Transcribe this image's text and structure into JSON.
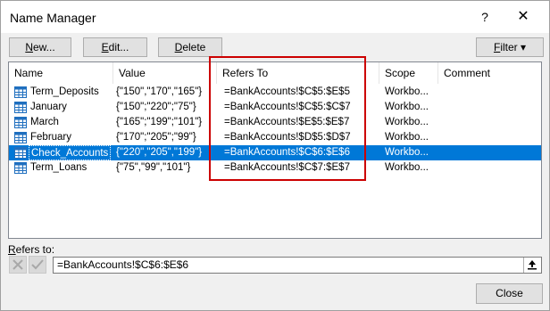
{
  "dialog": {
    "title": "Name Manager",
    "help_label": "?",
    "close_label": "✕"
  },
  "toolbar": {
    "new_label_ul": "N",
    "new_label_rest": "ew...",
    "edit_label_ul": "E",
    "edit_label_rest": "dit...",
    "delete_label_ul": "D",
    "delete_label_rest": "elete",
    "filter_label_ul": "F",
    "filter_label_rest": "ilter ▾"
  },
  "columns": {
    "name": "Name",
    "value": "Value",
    "refers_to": "Refers To",
    "scope": "Scope",
    "comment": "Comment"
  },
  "rows": [
    {
      "name": "Term_Deposits",
      "value": "{\"150\",\"170\",\"165\"}",
      "refers_to": "=BankAccounts!$C$5:$E$5",
      "scope": "Workbo...",
      "selected": false
    },
    {
      "name": "January",
      "value": "{\"150\";\"220\";\"75\"}",
      "refers_to": "=BankAccounts!$C$5:$C$7",
      "scope": "Workbo...",
      "selected": false
    },
    {
      "name": "March",
      "value": "{\"165\";\"199\";\"101\"}",
      "refers_to": "=BankAccounts!$E$5:$E$7",
      "scope": "Workbo...",
      "selected": false
    },
    {
      "name": "February",
      "value": "{\"170\";\"205\";\"99\"}",
      "refers_to": "=BankAccounts!$D$5:$D$7",
      "scope": "Workbo...",
      "selected": false
    },
    {
      "name": "Check_Accounts",
      "value": "{\"220\",\"205\",\"199\"}",
      "refers_to": "=BankAccounts!$C$6:$E$6",
      "scope": "Workbo...",
      "selected": true
    },
    {
      "name": "Term_Loans",
      "value": "{\"75\",\"99\",\"101\"}",
      "refers_to": "=BankAccounts!$C$7:$E$7",
      "scope": "Workbo...",
      "selected": false
    }
  ],
  "refers_to": {
    "label_ul": "R",
    "label_rest": "efers to:",
    "value": "=BankAccounts!$C$6:$E$6"
  },
  "footer": {
    "close_label": "Close"
  },
  "colors": {
    "selection": "#0078d7",
    "highlight_border": "#cc0000",
    "name_icon": "#1f6fbf"
  },
  "icons": {
    "name_row": "defined-name-table-icon",
    "cancel_edit": "cancel-x-icon",
    "enter_edit": "enter-check-icon",
    "collapse": "collapse-dialog-icon"
  }
}
